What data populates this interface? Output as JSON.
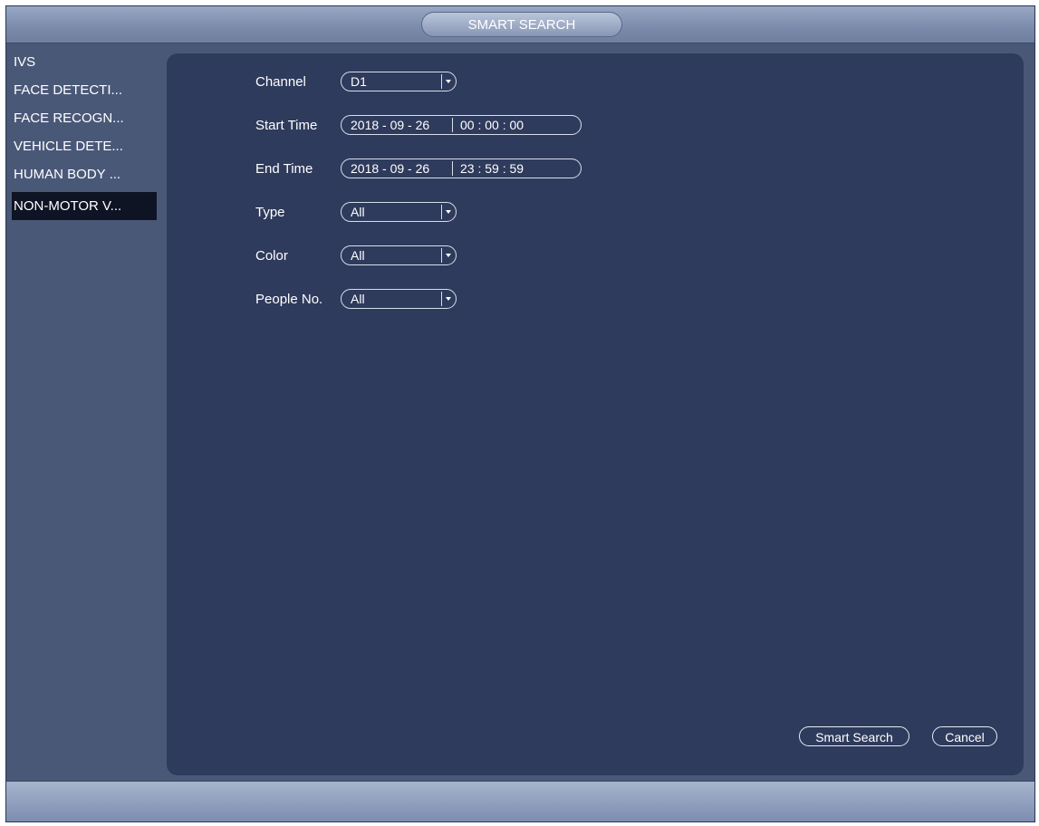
{
  "window": {
    "title": "SMART SEARCH"
  },
  "sidebar": {
    "items": [
      {
        "label": "IVS"
      },
      {
        "label": "FACE DETECTI..."
      },
      {
        "label": "FACE RECOGN..."
      },
      {
        "label": "VEHICLE DETE..."
      },
      {
        "label": "HUMAN BODY ..."
      },
      {
        "label": "NON-MOTOR V..."
      }
    ],
    "active_index": 5
  },
  "form": {
    "channel": {
      "label": "Channel",
      "value": "D1"
    },
    "start_time": {
      "label": "Start Time",
      "date": "2018  - 09  - 26",
      "time": "00  : 00  : 00"
    },
    "end_time": {
      "label": "End Time",
      "date": "2018  - 09  - 26",
      "time": "23  : 59  : 59"
    },
    "type": {
      "label": "Type",
      "value": "All"
    },
    "color": {
      "label": "Color",
      "value": "All"
    },
    "people_no": {
      "label": "People No.",
      "value": "All"
    }
  },
  "buttons": {
    "smart_search": "Smart Search",
    "cancel": "Cancel"
  },
  "colors": {
    "panel": "#2f3b5c",
    "window": "#4a5878",
    "active_item": "#0e1424"
  }
}
